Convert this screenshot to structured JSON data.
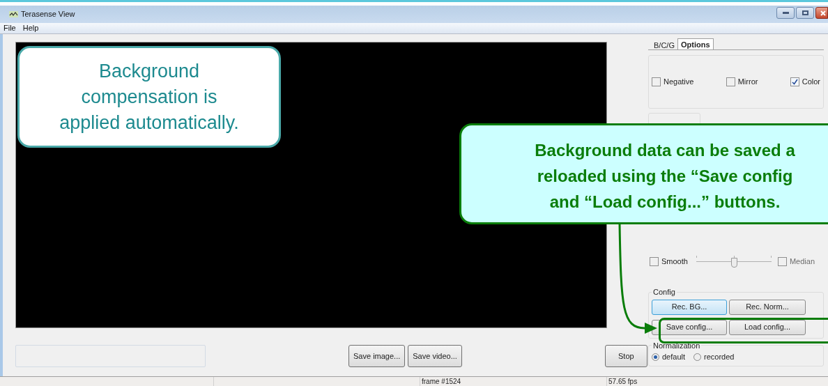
{
  "window": {
    "title": "Terasense View"
  },
  "menu": [
    "File",
    "Help"
  ],
  "video_buttons": [
    "Save image...",
    "Save video..."
  ],
  "stop_button": "Stop",
  "tabs": [
    {
      "label": "B/C/G",
      "selected": false
    },
    {
      "label": "Options",
      "selected": true
    }
  ],
  "options": [
    {
      "label": "Negative",
      "checked": false
    },
    {
      "label": "Mirror",
      "checked": false
    },
    {
      "label": "Color",
      "checked": true
    }
  ],
  "filter": {
    "smooth": {
      "label": "Smooth",
      "checked": false
    },
    "level": 0.5,
    "median": {
      "label": "Median",
      "checked": false
    }
  },
  "config": {
    "title": "Config",
    "buttons": [
      {
        "label": "Rec. BG...",
        "focused": true
      },
      {
        "label": "Rec. Norm...",
        "focused": false
      },
      {
        "label": "Save config...",
        "focused": false
      },
      {
        "label": "Load config...",
        "focused": false
      }
    ]
  },
  "normalization": {
    "title": "Normalization",
    "options": [
      {
        "label": "default",
        "selected": true
      },
      {
        "label": "recorded",
        "selected": false
      }
    ]
  },
  "status_bar": [
    "frame #1524",
    "57.65 fps"
  ],
  "callouts": [
    {
      "kind": "note",
      "lines": [
        "Background",
        "compensation is",
        "applied automatically."
      ]
    },
    {
      "kind": "pointer",
      "lines": [
        "Background data can be saved a",
        "reloaded using the “Save config",
        "and “Load config...” buttons."
      ]
    }
  ]
}
